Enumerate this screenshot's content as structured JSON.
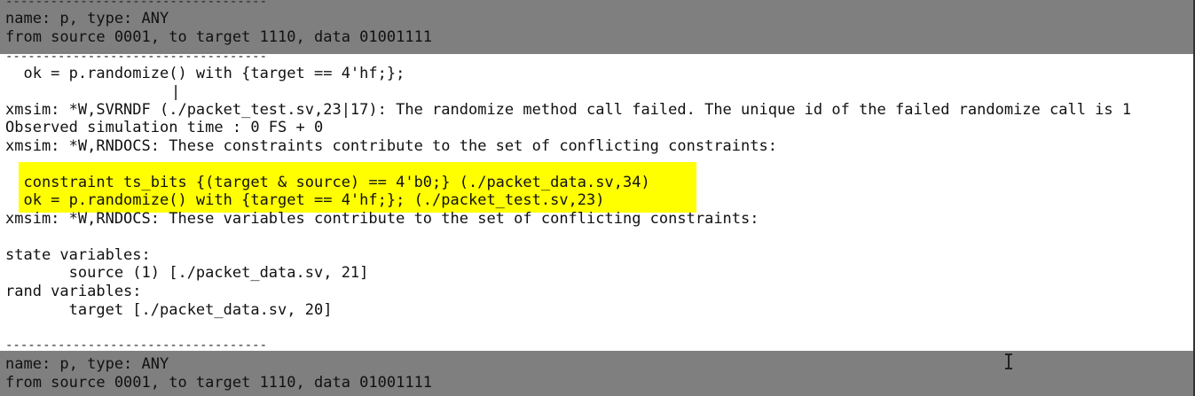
{
  "console": {
    "top_block": {
      "dash_line": "-----------------------------------",
      "lines": [
        "name: p, type: ANY",
        "from source 0001, to target 1110, data 01001111"
      ],
      "dash_line_after": "-----------------------------------"
    },
    "statement": "  ok = p.randomize() with {target == 4'hf;};",
    "caret": "|",
    "warning_svrndf": "xmsim: *W,SVRNDF (./packet_test.sv,23|17): The randomize method call failed. The unique id of the failed randomize call is 1",
    "sim_time": "Observed simulation time : 0 FS + 0",
    "warning_constraints": "xmsim: *W,RNDOCS: These constraints contribute to the set of conflicting constraints:",
    "conflicting_constraints": [
      "  constraint ts_bits {(target & source) == 4'b0;} (./packet_data.sv,34)",
      "  ok = p.randomize() with {target == 4'hf;}; (./packet_test.sv,23)"
    ],
    "warning_variables": "xmsim: *W,RNDOCS: These variables contribute to the set of conflicting constraints:",
    "state_variables_header": "state variables:",
    "state_variables": [
      "       source (1) [./packet_data.sv, 21]"
    ],
    "rand_variables_header": "rand variables:",
    "rand_variables": [
      "       target [./packet_data.sv, 20]"
    ],
    "bottom_block": {
      "dash_line": "-----------------------------------",
      "lines": [
        "name: p, type: ANY",
        "from source 0001, to target 1110, data 01001111"
      ]
    },
    "colors": {
      "band": "#7f7f7f",
      "highlight": "#ffff00",
      "text": "#111111",
      "background": "#ffffff"
    }
  }
}
